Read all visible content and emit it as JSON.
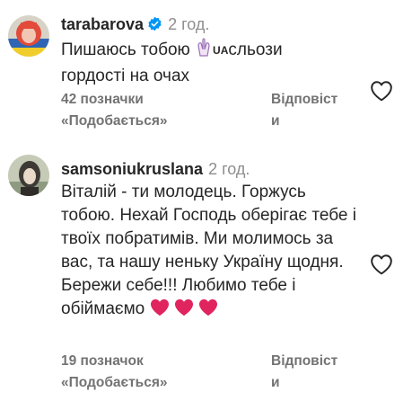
{
  "comments": [
    {
      "username": "tarabarova",
      "verified": true,
      "time": "2 год.",
      "text_lines": [
        "Пишаюсь тобою",
        "UA",
        "сльози",
        "гордості на очах"
      ],
      "likes": "42 позначки",
      "likes_suffix": "«Подобається»",
      "reply_top": "Відповіст",
      "reply_bottom": "и",
      "icons": [
        "avatar-photo",
        "verified-badge-icon",
        "hands-emoji-icon",
        "heart-outline-icon"
      ]
    },
    {
      "username": "samsoniukruslana",
      "verified": false,
      "time": "2 год.",
      "text": "Віталій - ти молодець. Горжусь тобою. Нехай Господь оберігає тебе і твоїх побратимів. Ми молимось за вас, та нашу неньку Україну щодня. Бережи себе!!! Любимо тебе і обіймаємо",
      "likes": "19 позначок",
      "likes_suffix": "«Подобається»",
      "reply_top": "Відповіст",
      "reply_bottom": "и",
      "icons": [
        "avatar-photo",
        "red-heart-emoji",
        "heart-outline-icon"
      ]
    }
  ],
  "colors": {
    "text": "#262626",
    "secondary": "#737373",
    "verified": "#0095f6",
    "heart": "#e0245e"
  }
}
